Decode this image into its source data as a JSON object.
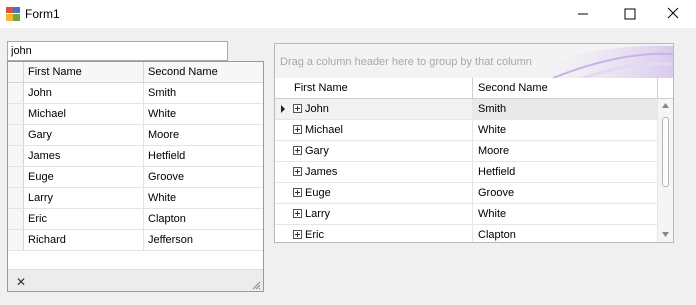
{
  "window": {
    "title": "Form1",
    "icon": "winforms-app-icon",
    "controls": [
      "minimize-icon",
      "maximize-icon",
      "close-icon"
    ]
  },
  "left": {
    "search_value": "john",
    "columns": [
      "First Name",
      "Second Name"
    ],
    "rows": [
      [
        "John",
        "Smith"
      ],
      [
        "Michael",
        "White"
      ],
      [
        "Gary",
        "Moore"
      ],
      [
        "James",
        "Hetfield"
      ],
      [
        "Euge",
        "Groove"
      ],
      [
        "Larry",
        "White"
      ],
      [
        "Eric",
        "Clapton"
      ],
      [
        "Richard",
        "Jefferson"
      ]
    ],
    "footer_clear_icon": "x-icon"
  },
  "right": {
    "group_panel_text": "Drag a column header here to group by that column",
    "columns": [
      "First Name",
      "Second Name"
    ],
    "rows": [
      [
        "John",
        "Smith"
      ],
      [
        "Michael",
        "White"
      ],
      [
        "Gary",
        "Moore"
      ],
      [
        "James",
        "Hetfield"
      ],
      [
        "Euge",
        "Groove"
      ],
      [
        "Larry",
        "White"
      ],
      [
        "Eric",
        "Clapton"
      ]
    ],
    "focused_row": 0
  }
}
